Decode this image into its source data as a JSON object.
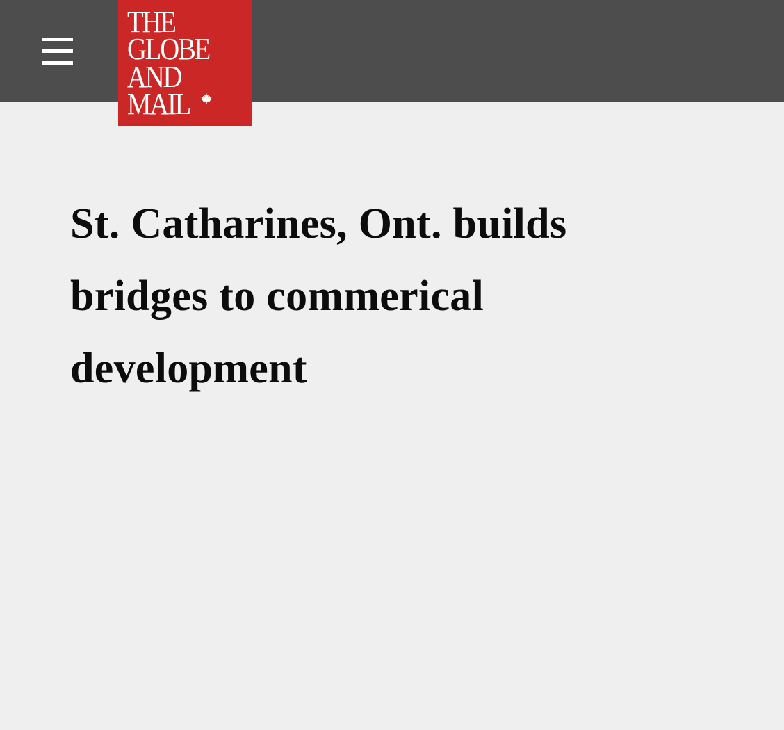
{
  "header": {
    "menu_icon": "hamburger-menu-icon",
    "background_color": "#4d4d4d",
    "logo": {
      "lines": [
        "THE",
        "GLOBE",
        "AND",
        "MAIL"
      ],
      "icon": "maple-leaf-icon",
      "color": "#cc2727"
    }
  },
  "article": {
    "headline": "St. Catharines, Ont. builds bridges to commerical development"
  },
  "page": {
    "background_color": "#efefef"
  }
}
